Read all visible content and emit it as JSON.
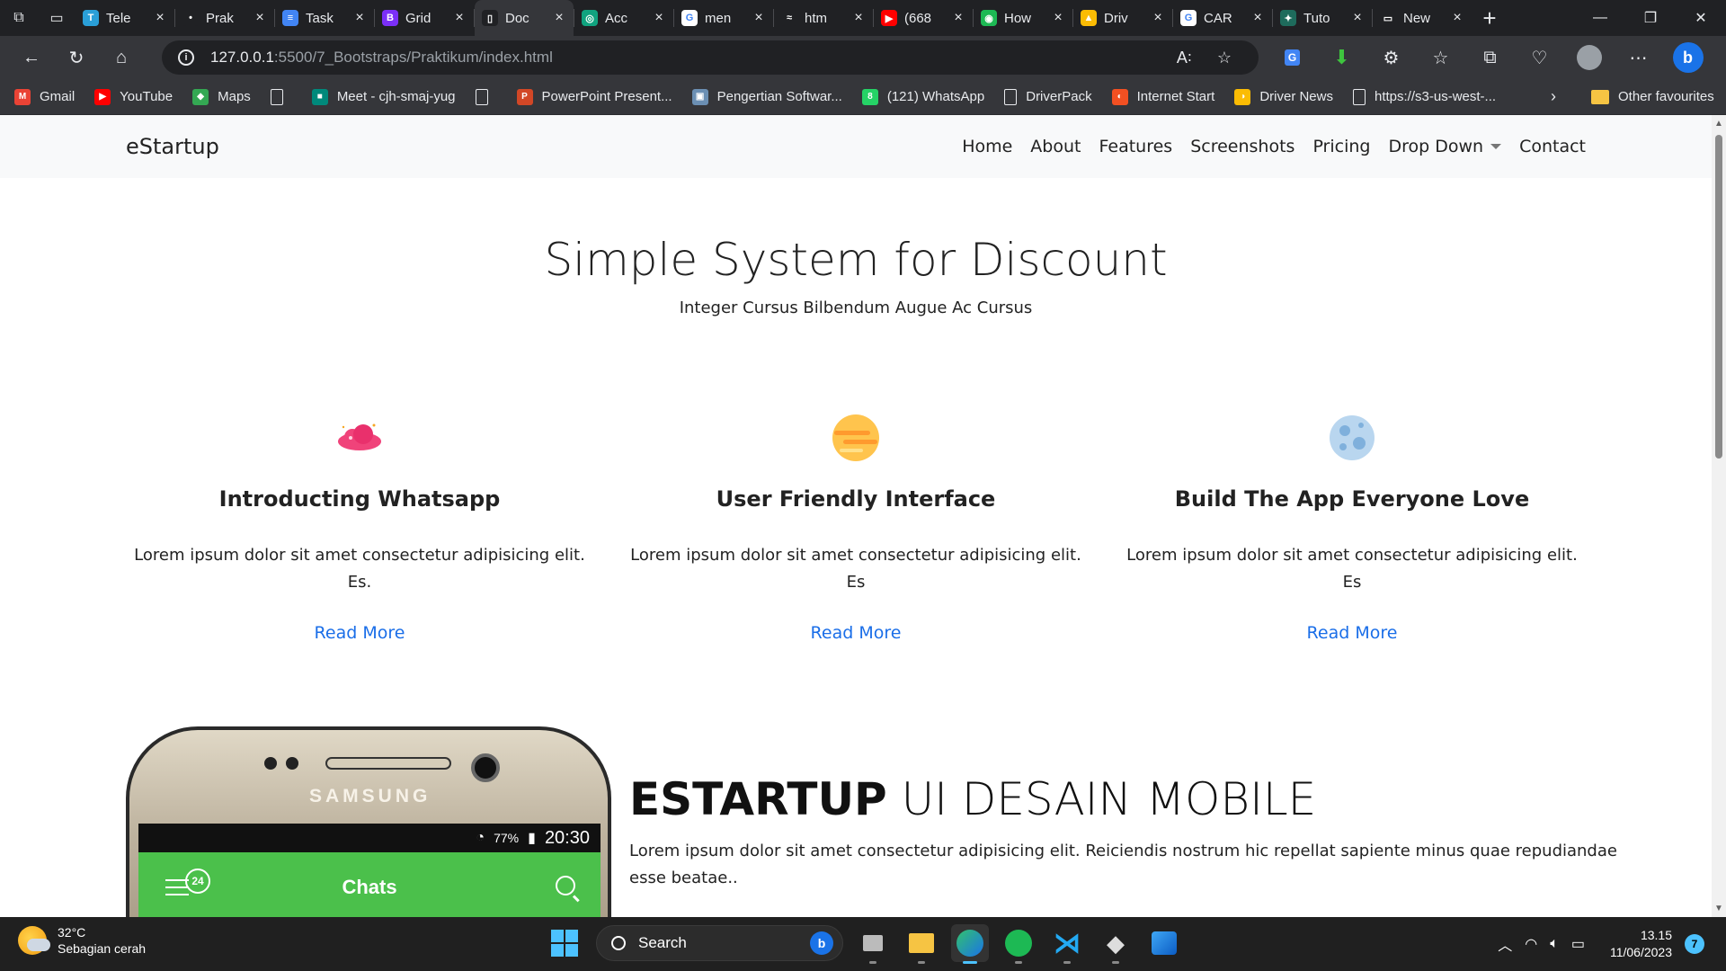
{
  "browser": {
    "tabs": [
      {
        "label": "Tele",
        "color": "#2a9fd8",
        "glyph": "T"
      },
      {
        "label": "Prak",
        "color": "#202124",
        "glyph": "•"
      },
      {
        "label": "Task",
        "color": "#4285f4",
        "glyph": "≡"
      },
      {
        "label": "Grid",
        "color": "#7b2ff7",
        "glyph": "B"
      },
      {
        "label": "Doc",
        "color": "#202124",
        "glyph": "▯",
        "active": true
      },
      {
        "label": "Acc",
        "color": "#10a37f",
        "glyph": "◎"
      },
      {
        "label": "men",
        "color": "#ffffff",
        "glyph": "G"
      },
      {
        "label": "htm",
        "color": "#202124",
        "glyph": "≈"
      },
      {
        "label": "(668",
        "color": "#ff0000",
        "glyph": "▶"
      },
      {
        "label": "How",
        "color": "#1db954",
        "glyph": "◉"
      },
      {
        "label": "Driv",
        "color": "#fbbc04",
        "glyph": "▲"
      },
      {
        "label": "CAR",
        "color": "#ffffff",
        "glyph": "G"
      },
      {
        "label": "Tuto",
        "color": "#1e6b5c",
        "glyph": "✦"
      },
      {
        "label": "New",
        "color": "#202124",
        "glyph": "▭"
      }
    ],
    "address": {
      "host": "127.0.0.1",
      "path": ":5500/7_Bootstraps/Praktikum/index.html"
    },
    "bookmarks": [
      {
        "label": "Gmail",
        "color": "#ea4335",
        "glyph": "M"
      },
      {
        "label": "YouTube",
        "color": "#ff0000",
        "glyph": "▶"
      },
      {
        "label": "Maps",
        "color": "#34a853",
        "glyph": "◆"
      },
      {
        "label": "",
        "doc": true
      },
      {
        "label": "Meet - cjh-smaj-yug",
        "color": "#00897b",
        "glyph": "■"
      },
      {
        "label": "",
        "doc": true
      },
      {
        "label": "PowerPoint Present...",
        "color": "#d24726",
        "glyph": "P"
      },
      {
        "label": "Pengertian Softwar...",
        "color": "#6b8fb3",
        "glyph": "▣"
      },
      {
        "label": "(121) WhatsApp",
        "color": "#25d366",
        "glyph": "8"
      },
      {
        "label": "DriverPack",
        "doc": true
      },
      {
        "label": "Internet Start",
        "color": "#f25022",
        "glyph": "◐"
      },
      {
        "label": "Driver News",
        "color": "#fbbc04",
        "glyph": "◑"
      },
      {
        "label": "https://s3-us-west-...",
        "doc": true
      }
    ],
    "other_favourites": "Other favourites"
  },
  "page": {
    "brand": "eStartup",
    "nav": {
      "home": "Home",
      "about": "About",
      "features": "Features",
      "screenshots": "Screenshots",
      "pricing": "Pricing",
      "dropdown": "Drop Down",
      "contact": "Contact"
    },
    "hero": {
      "title": "Simple System for Discount",
      "subtitle": "Integer Cursus Bilbendum Augue Ac Cursus"
    },
    "features": [
      {
        "title": "Introducting Whatsapp",
        "text": "Lorem ipsum dolor sit amet consectetur adipisicing elit. Es.",
        "link": "Read More",
        "icon": "pink-cloud-icon"
      },
      {
        "title": "User Friendly Interface",
        "text": "Lorem ipsum dolor sit amet consectetur adipisicing elit. Es",
        "link": "Read More",
        "icon": "orange-planet-icon"
      },
      {
        "title": "Build The App Everyone Love",
        "text": "Lorem ipsum dolor sit amet consectetur adipisicing elit. Es",
        "link": "Read More",
        "icon": "blue-moon-icon"
      }
    ],
    "mobile": {
      "title_bold": "ESTARTUP",
      "title_rest": " UI DESAIN MOBILE",
      "text": "Lorem ipsum dolor sit amet consectetur adipisicing elit. Reiciendis nostrum hic repellat sapiente minus quae repudiandae esse beatae..",
      "phone_brand": "SAMSUNG",
      "battery": "77%",
      "time": "20:30",
      "chats": "Chats",
      "badge": "24"
    }
  },
  "taskbar": {
    "temperature": "32°C",
    "weather": "Sebagian cerah",
    "search": "Search",
    "time": "13.15",
    "date": "11/06/2023",
    "notifications": "7"
  }
}
